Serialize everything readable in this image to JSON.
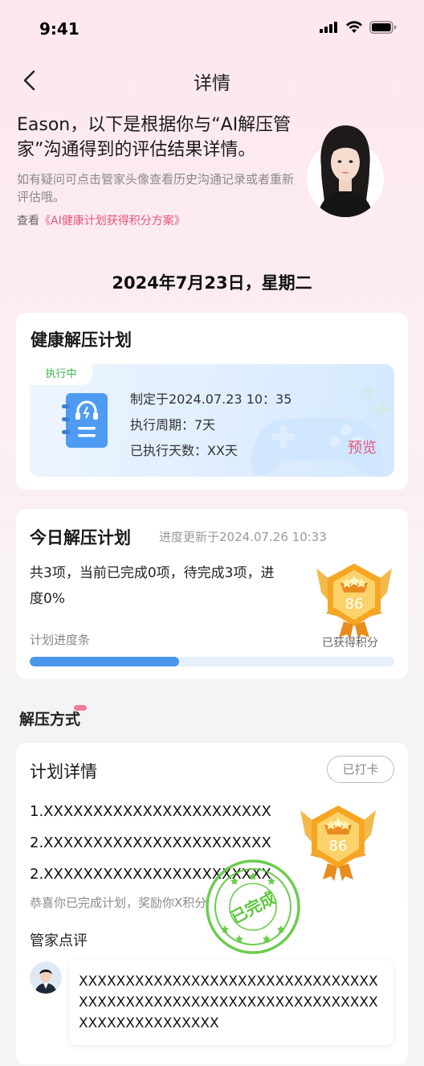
{
  "status_bar": {
    "time": "9:41"
  },
  "nav": {
    "title": "详情"
  },
  "intro": {
    "main": "Eason，以下是根据你与“AI解压管家”沟通得到的评估结果详情。",
    "sub": "如有疑问可点击管家头像查看历史沟通记录或者重新评估哦。",
    "link_prefix": "查看",
    "link_text": "《AI健康计划获得积分方案》"
  },
  "date": "2024年7月23日，星期二",
  "plan_card": {
    "title": "健康解压计划",
    "status_tag": "执行中",
    "created": "制定于2024.07.23 10：35",
    "period": "执行周期：7天",
    "days_done": "已执行天数：XX天",
    "preview_label": "预览"
  },
  "today_card": {
    "title": "今日解压计划",
    "update": "进度更新于2024.07.26   10:33",
    "summary": "共3项，当前已完成0项，待完成3项，进度0%",
    "bar_label": "计划进度条",
    "progress": 0.41,
    "badge_score": "86",
    "badge_label": "已获得积分"
  },
  "section": {
    "title": "解压方式"
  },
  "detail_card": {
    "title": "计划详情",
    "checkin_label": "已打卡",
    "items": [
      "1.XXXXXXXXXXXXXXXXXXXXXXX",
      "2.XXXXXXXXXXXXXXXXXXXXXXX",
      "2.XXXXXXXXXXXXXXXXXXXXXXX"
    ],
    "congrats": "恭喜你已完成计划，奖励你X积分",
    "badge_score": "86",
    "stamp_text": "已完成",
    "review_title": "管家点评",
    "review_text": "XXXXXXXXXXXXXXXXXXXXXXXXXXXXXXXXXXXXXXXXXXXXXXXXXXXXXXXXXXXXXXXXXXXXXXXXXXXXXXX"
  },
  "colors": {
    "accent_pink": "#e8557a",
    "progress_blue": "#4a96ec",
    "exec_green": "#39b54a",
    "stamp_green": "#5cc73a"
  }
}
